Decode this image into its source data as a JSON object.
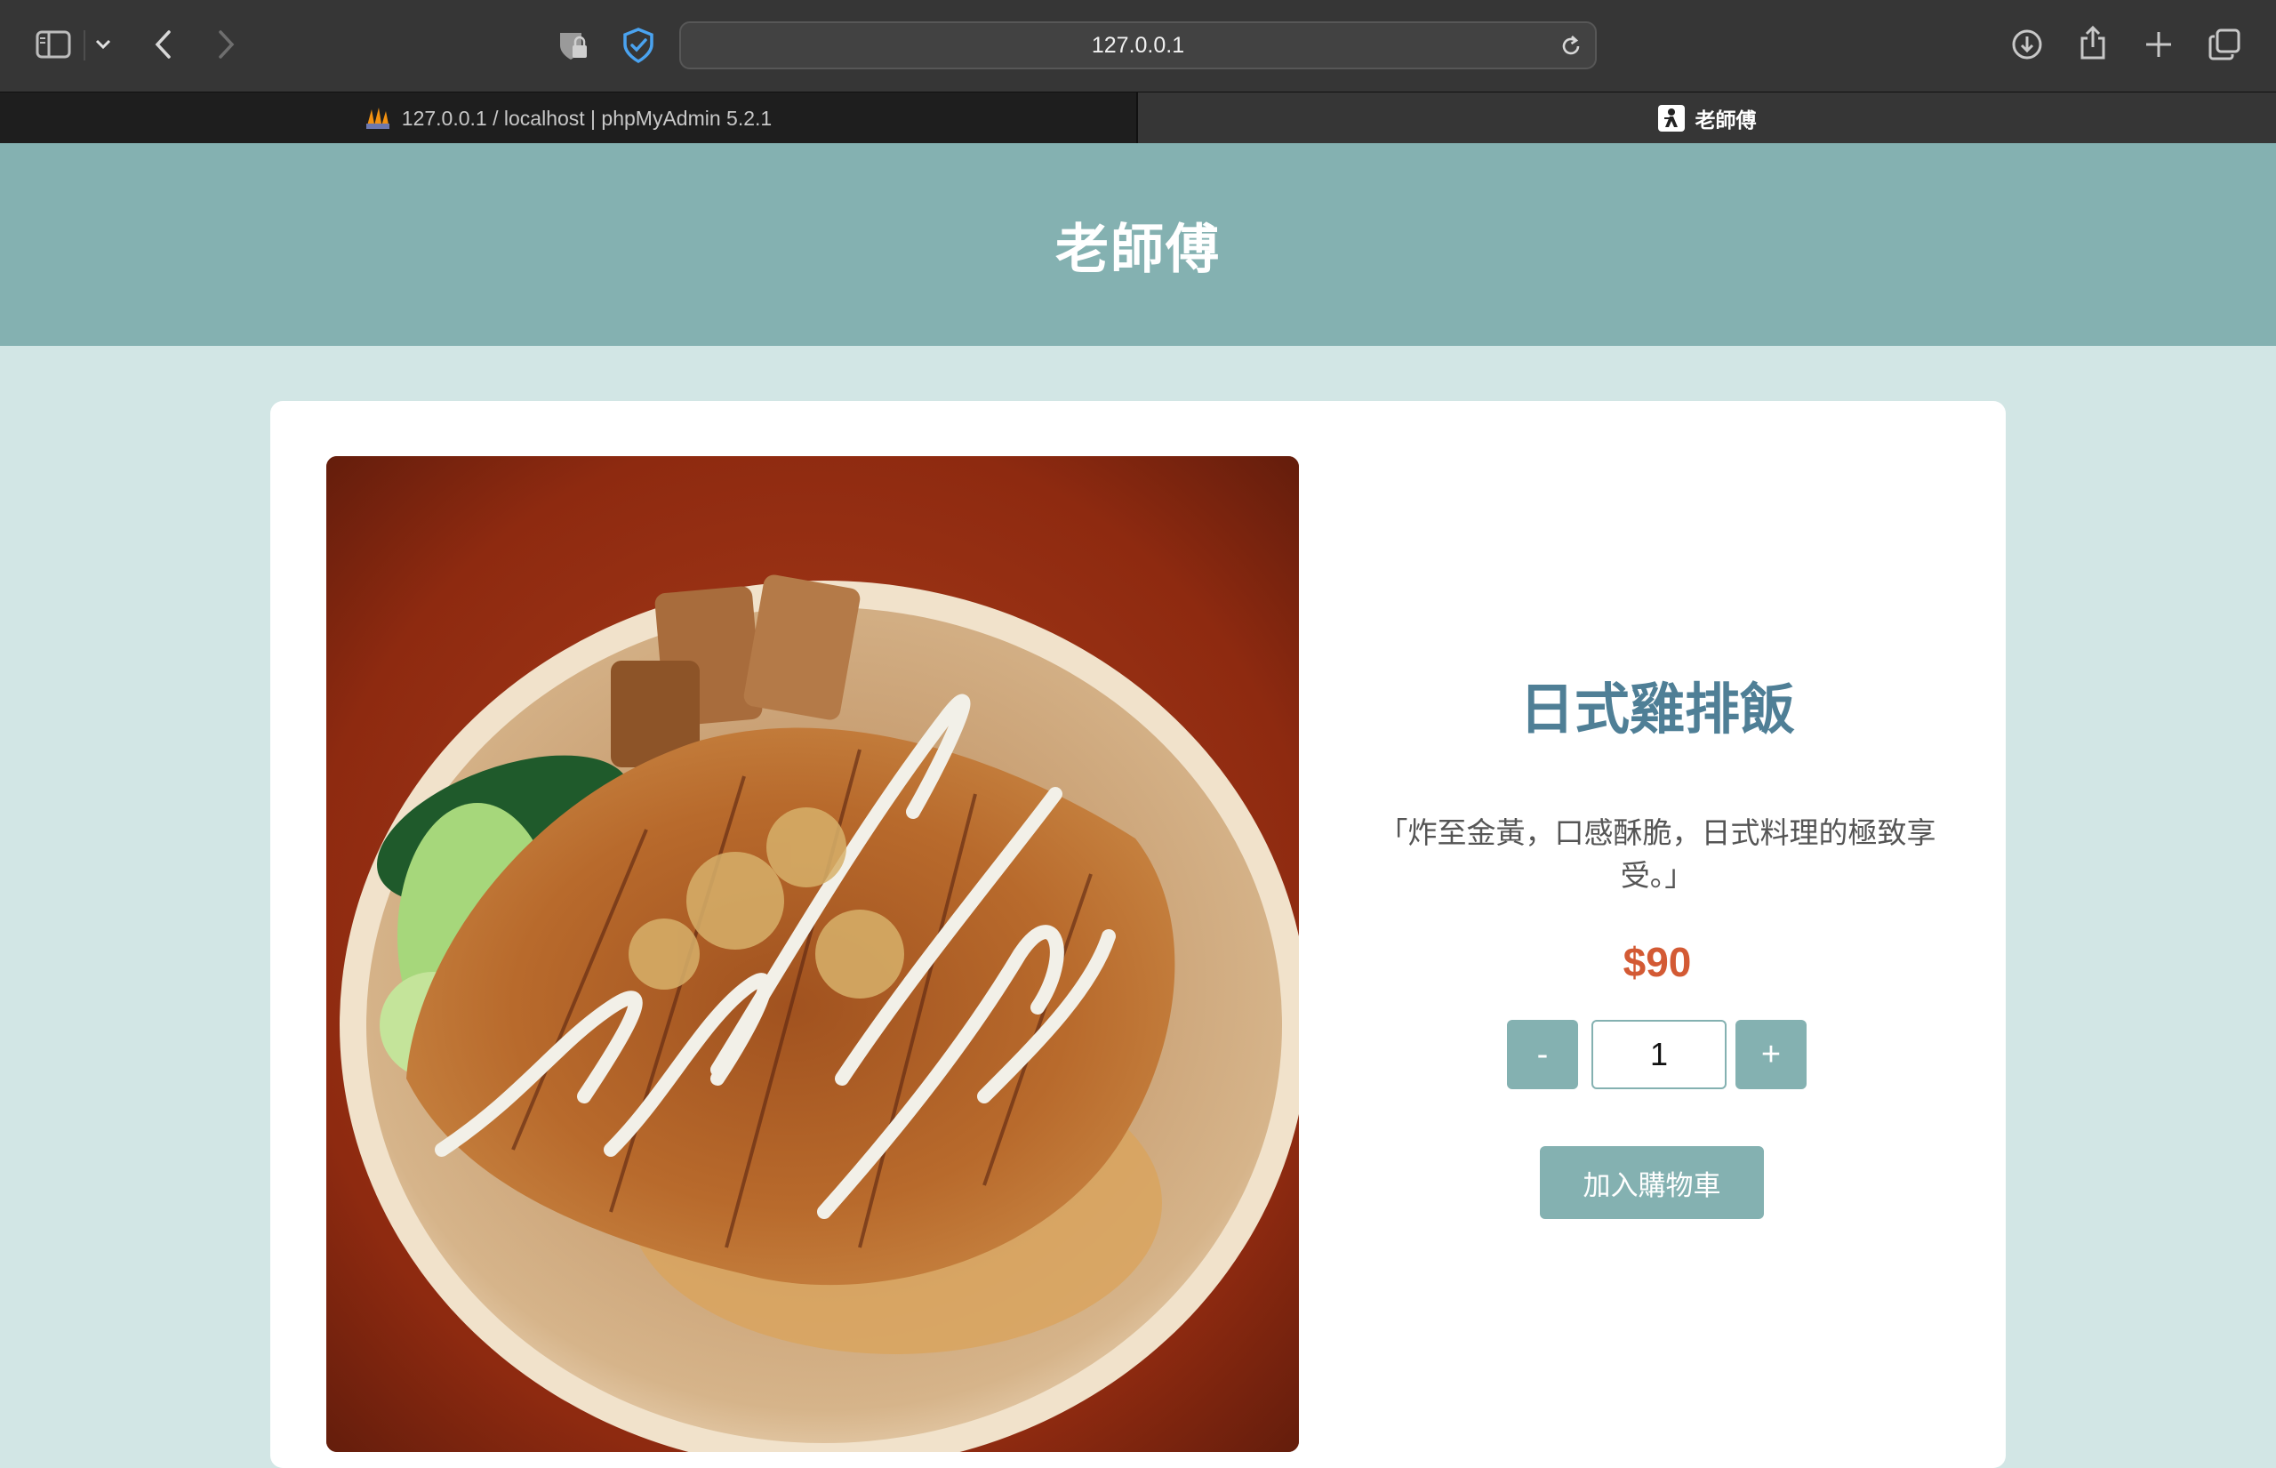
{
  "browser": {
    "url": "127.0.0.1",
    "tabs": [
      {
        "label": "127.0.0.1 / localhost | phpMyAdmin 5.2.1",
        "active": false
      },
      {
        "label": "老師傅",
        "active": true
      }
    ],
    "toolbar_icons": [
      "sidebar-icon",
      "chevron-down-icon",
      "back-icon",
      "forward-icon",
      "privacy-icon",
      "shield-check-icon",
      "reload-icon",
      "download-icon",
      "share-icon",
      "plus-icon",
      "tabs-overview-icon"
    ]
  },
  "site": {
    "title": "老師傅",
    "header_color": "#84b1b1",
    "background_color": "#d2e6e5"
  },
  "product": {
    "name": "日式雞排飯",
    "description": "「炸至金黃，口感酥脆，日式料理的極致享受。」",
    "price": "$90",
    "quantity": "1",
    "minus_label": "-",
    "plus_label": "+",
    "add_to_cart_label": "加入購物車",
    "image_alt": "日式雞排飯"
  },
  "colors": {
    "accent": "#84b1b1",
    "title": "#4f7f96",
    "price": "#d35a34"
  }
}
